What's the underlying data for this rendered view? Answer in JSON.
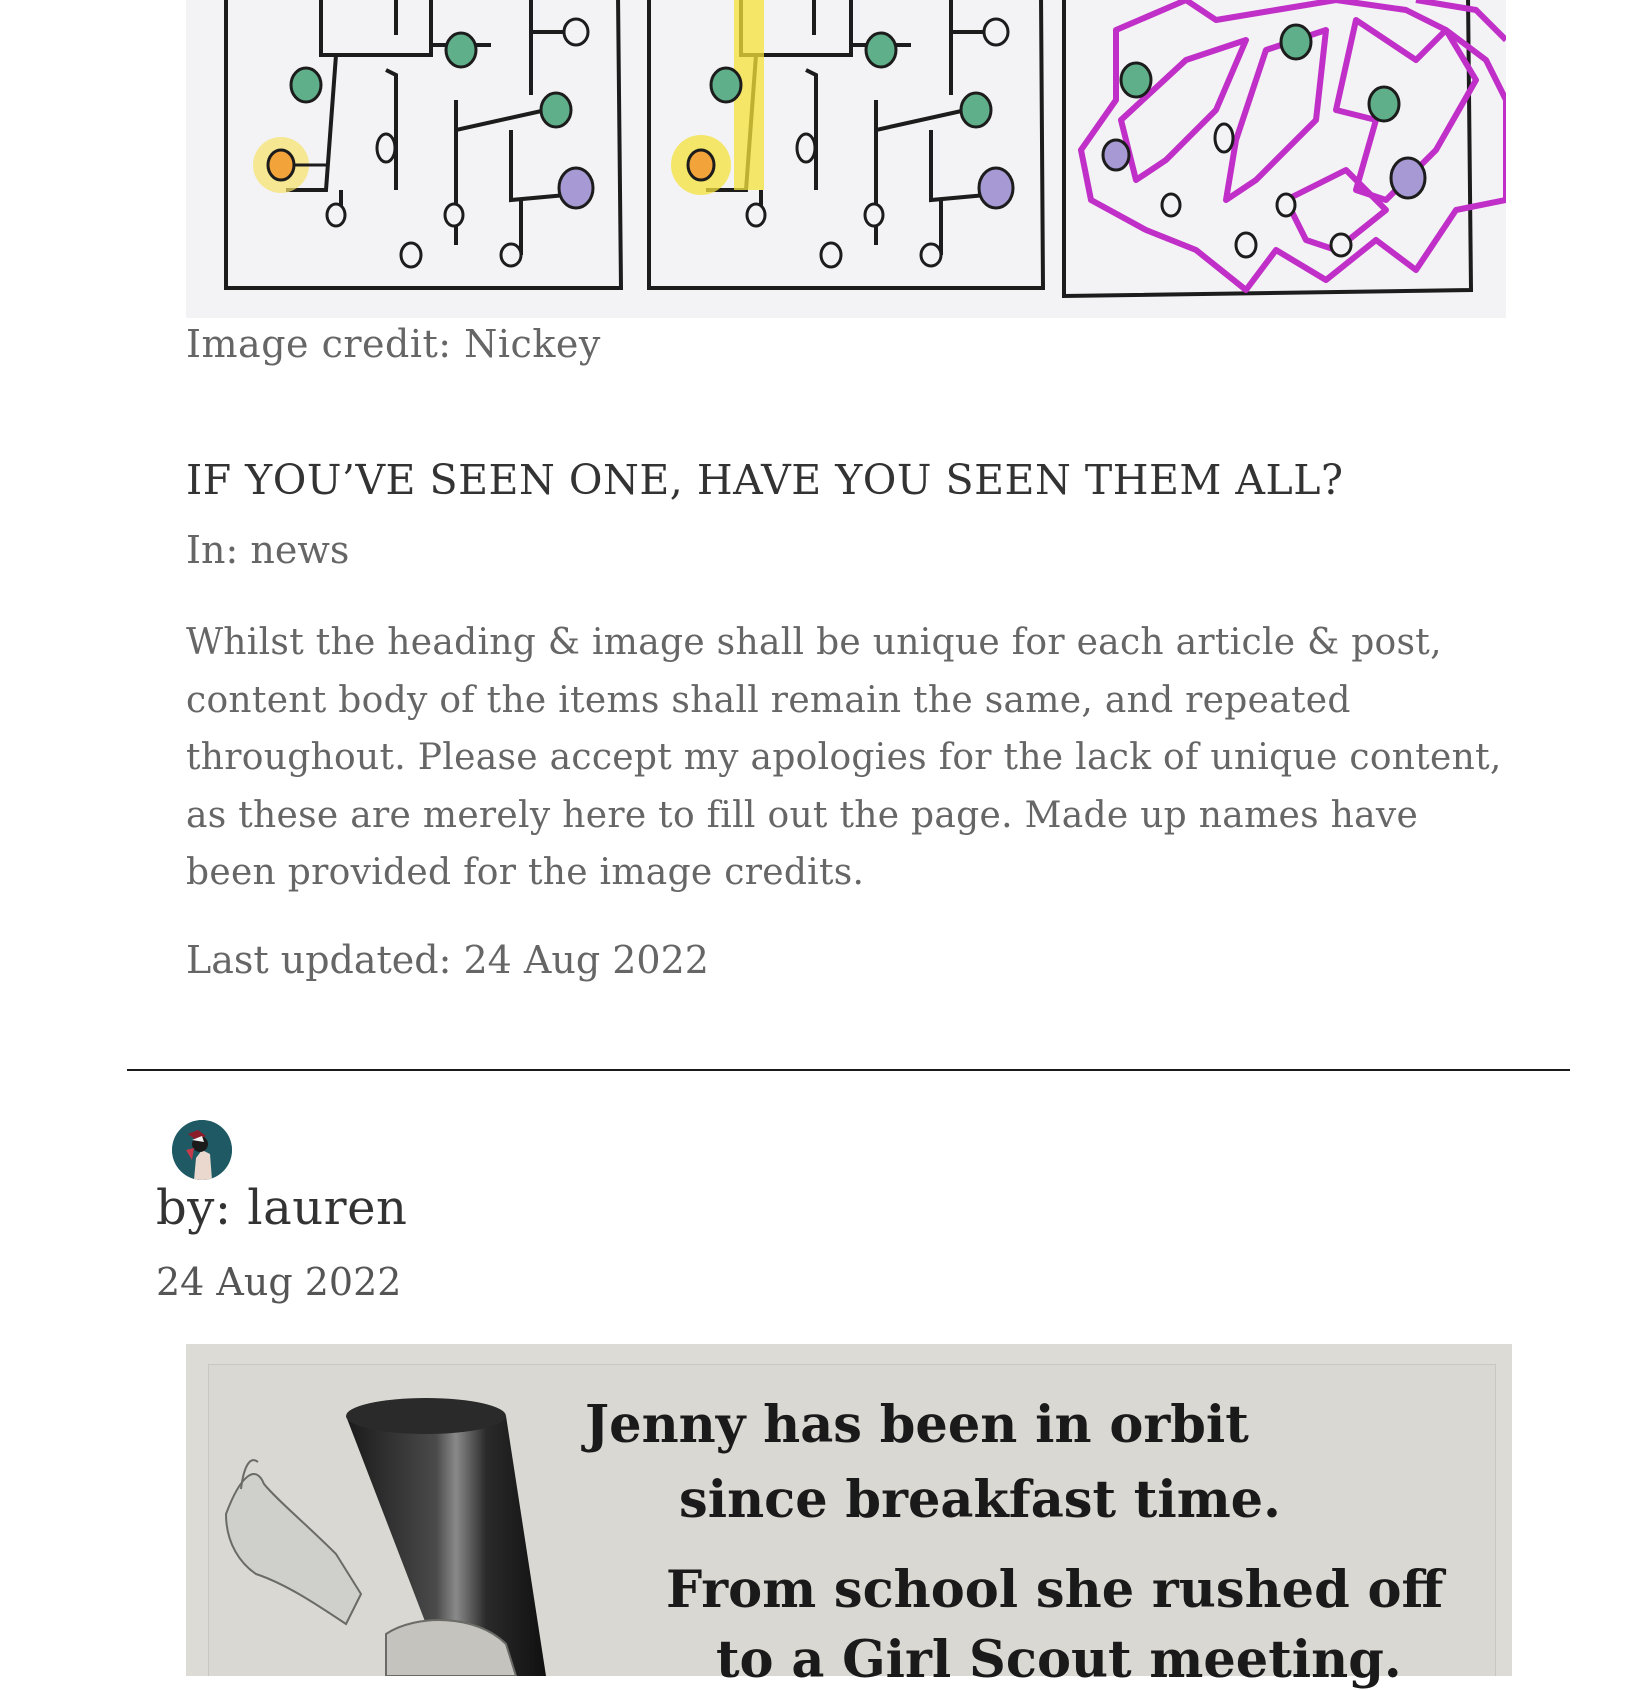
{
  "previous_post": {
    "image_alt_icon": "circuit-diagram-illustration",
    "image_credit": "Image credit: Nickey",
    "title": "IF YOU’VE SEEN ONE, HAVE YOU SEEN THEM ALL?",
    "category": "In: news",
    "body": "Whilst the heading & image shall be unique for each article & post, content body of the items shall remain the same, and repeated throughout. Please accept my apologies for the lack of unique content, as these are merely here to fill out the page. Made up names have been provided for the image credits.",
    "last_updated": "Last updated: 24 Aug 2022"
  },
  "next_post": {
    "author": "by: lauren",
    "date": "24 Aug 2022",
    "image_text": {
      "line1": "Jenny has been in orbit",
      "line2": "since breakfast time.",
      "line3": "From school she rushed off",
      "line4": "to a Girl Scout meeting."
    }
  },
  "colors": {
    "divider": "#1a1a1a",
    "text": "#666666",
    "heading": "#333333",
    "circuit_green": "#5fb08a",
    "circuit_purple": "#a79ad4",
    "circuit_orange": "#f2a33a",
    "highlight_yellow": "#f5e23a",
    "magenta": "#c02fc8"
  }
}
